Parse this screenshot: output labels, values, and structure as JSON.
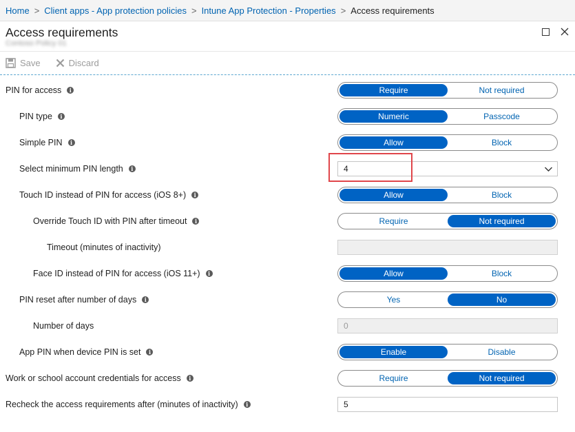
{
  "breadcrumb": {
    "items": [
      "Home",
      "Client apps - App protection policies",
      "Intune App Protection - Properties"
    ],
    "current": "Access requirements",
    "separator": ">"
  },
  "blade": {
    "title": "Access requirements",
    "subtitle": "Contoso Policy 01"
  },
  "toolbar": {
    "save_label": "Save",
    "discard_label": "Discard"
  },
  "settings": {
    "pin_for_access": {
      "label": "PIN for access",
      "options": [
        "Require",
        "Not required"
      ],
      "selected": "Require"
    },
    "pin_type": {
      "label": "PIN type",
      "options": [
        "Numeric",
        "Passcode"
      ],
      "selected": "Numeric"
    },
    "simple_pin": {
      "label": "Simple PIN",
      "options": [
        "Allow",
        "Block"
      ],
      "selected": "Allow"
    },
    "min_pin_length": {
      "label": "Select minimum PIN length",
      "value": "4"
    },
    "touch_id": {
      "label": "Touch ID instead of PIN for access (iOS 8+)",
      "options": [
        "Allow",
        "Block"
      ],
      "selected": "Allow"
    },
    "override_touch_id": {
      "label": "Override Touch ID with PIN after timeout",
      "options": [
        "Require",
        "Not required"
      ],
      "selected": "Not required"
    },
    "timeout": {
      "label": "Timeout (minutes of inactivity)",
      "value": ""
    },
    "face_id": {
      "label": "Face ID instead of PIN for access (iOS 11+)",
      "options": [
        "Allow",
        "Block"
      ],
      "selected": "Allow"
    },
    "pin_reset": {
      "label": "PIN reset after number of days",
      "options": [
        "Yes",
        "No"
      ],
      "selected": "No"
    },
    "number_of_days": {
      "label": "Number of days",
      "value": "0"
    },
    "app_pin_device_pin": {
      "label": "App PIN when device PIN is set",
      "options": [
        "Enable",
        "Disable"
      ],
      "selected": "Enable"
    },
    "work_credentials": {
      "label": "Work or school account credentials for access",
      "options": [
        "Require",
        "Not required"
      ],
      "selected": "Not required"
    },
    "recheck": {
      "label": "Recheck the access requirements after (minutes of inactivity)",
      "value": "5"
    }
  },
  "colors": {
    "accent": "#0063c4",
    "link": "#0063b1",
    "highlight": "#e0454a"
  }
}
